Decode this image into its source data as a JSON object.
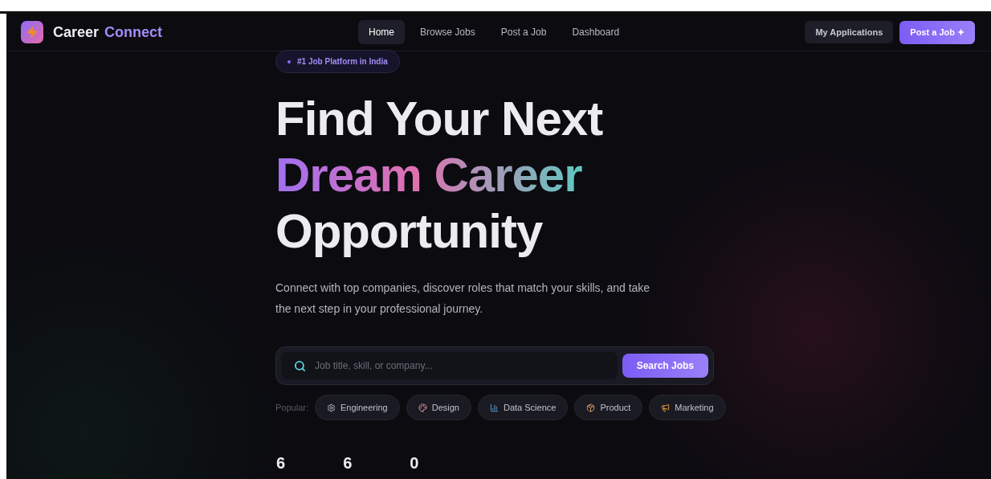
{
  "brand": {
    "first": "Career",
    "second": "Connect"
  },
  "nav": [
    {
      "label": "Home",
      "selected": true
    },
    {
      "label": "Browse Jobs",
      "selected": false
    },
    {
      "label": "Post a Job",
      "selected": false
    },
    {
      "label": "Dashboard",
      "selected": false
    }
  ],
  "actions": [
    {
      "label": "My Applications",
      "kind": "secondary"
    },
    {
      "label": "Post a Job ✦",
      "kind": "primary"
    }
  ],
  "badge": "#1 Job Platform in India",
  "headline": [
    {
      "text": "Find Your Next",
      "kind": "plain"
    },
    {
      "text": "Dream Career",
      "kind": "gradient"
    },
    {
      "text": "Opportunity",
      "kind": "plain"
    }
  ],
  "subtitle": "Connect with top companies, discover roles that match your skills, and take the next step in your professional journey.",
  "search": {
    "placeholder": "Job title, skill, or company...",
    "button": "Search Jobs"
  },
  "popular": {
    "label": "Popular:",
    "tags": [
      {
        "label": "Engineering",
        "kind": "gear"
      },
      {
        "label": "Design",
        "kind": "palette"
      },
      {
        "label": "Data Science",
        "kind": "chart"
      },
      {
        "label": "Product",
        "kind": "package"
      },
      {
        "label": "Marketing",
        "kind": "megaphone"
      }
    ]
  },
  "stats": [
    "6",
    "6",
    "0"
  ]
}
